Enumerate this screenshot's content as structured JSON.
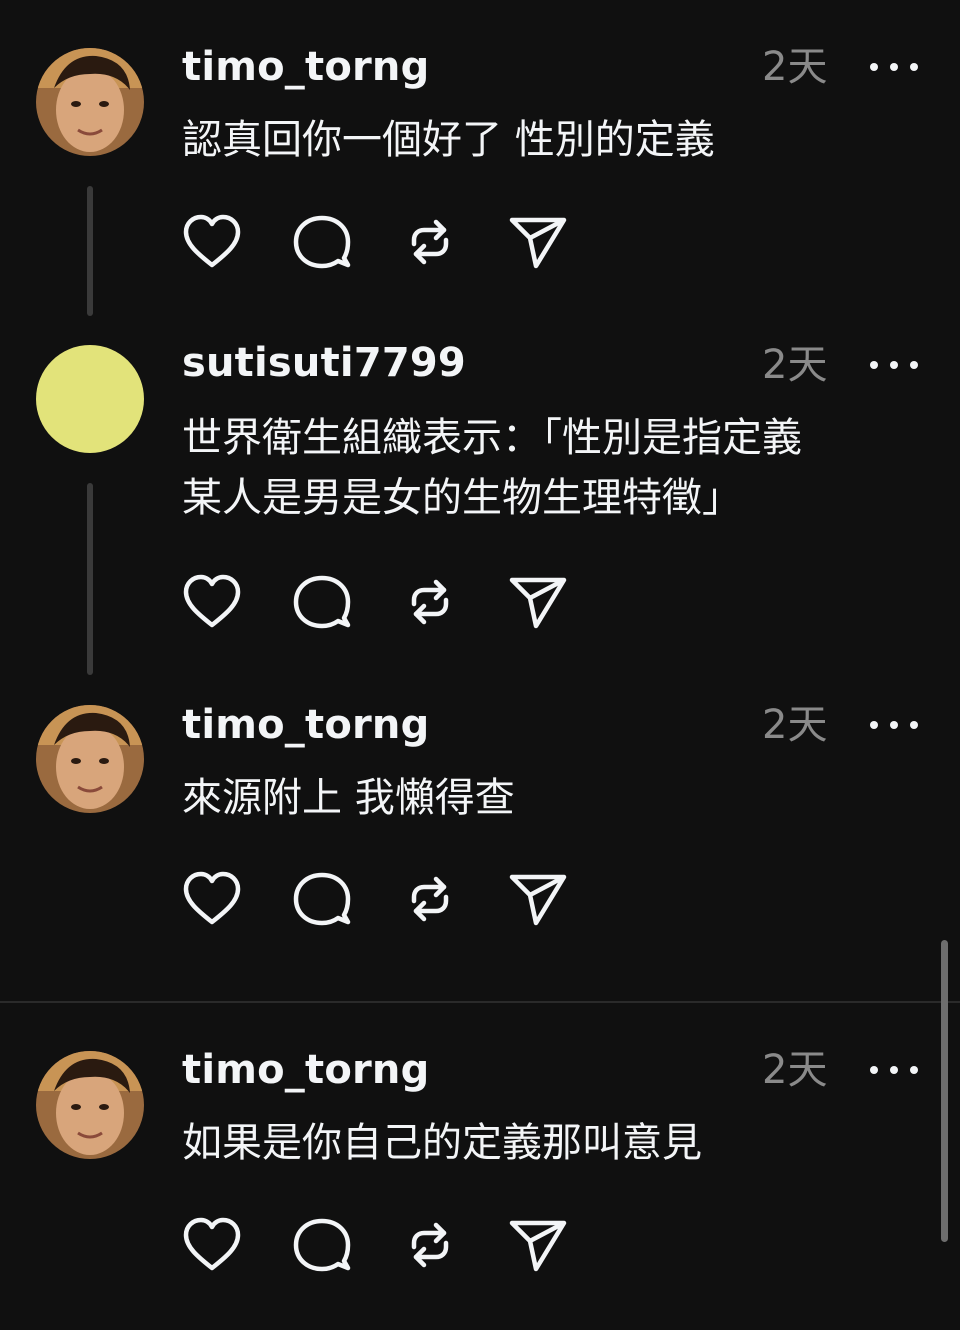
{
  "comments": [
    {
      "username": "timo_torng",
      "time": "2天",
      "text": "認真回你一個好了 性別的定義",
      "avatar": "photo"
    },
    {
      "username": "sutisuti7799",
      "time": "2天",
      "text": "世界衛生組織表示：「性別是指定義\n某人是男是女的生物生理特徵」",
      "avatar": "yellow"
    },
    {
      "username": "timo_torng",
      "time": "2天",
      "text": "來源附上 我懶得查",
      "avatar": "photo"
    },
    {
      "username": "timo_torng",
      "time": "2天",
      "text": "如果是你自己的定義那叫意見",
      "avatar": "photo"
    }
  ],
  "icons": {
    "like": "heart-icon",
    "reply": "comment-icon",
    "repost": "repost-icon",
    "share": "send-icon",
    "more": "more-dots-icon"
  },
  "colors": {
    "background": "#101010",
    "text": "#f3f5f7",
    "muted": "#8a8a8a",
    "avatar_yellow": "#e2e37a",
    "thread_line": "#3a3a3a"
  }
}
